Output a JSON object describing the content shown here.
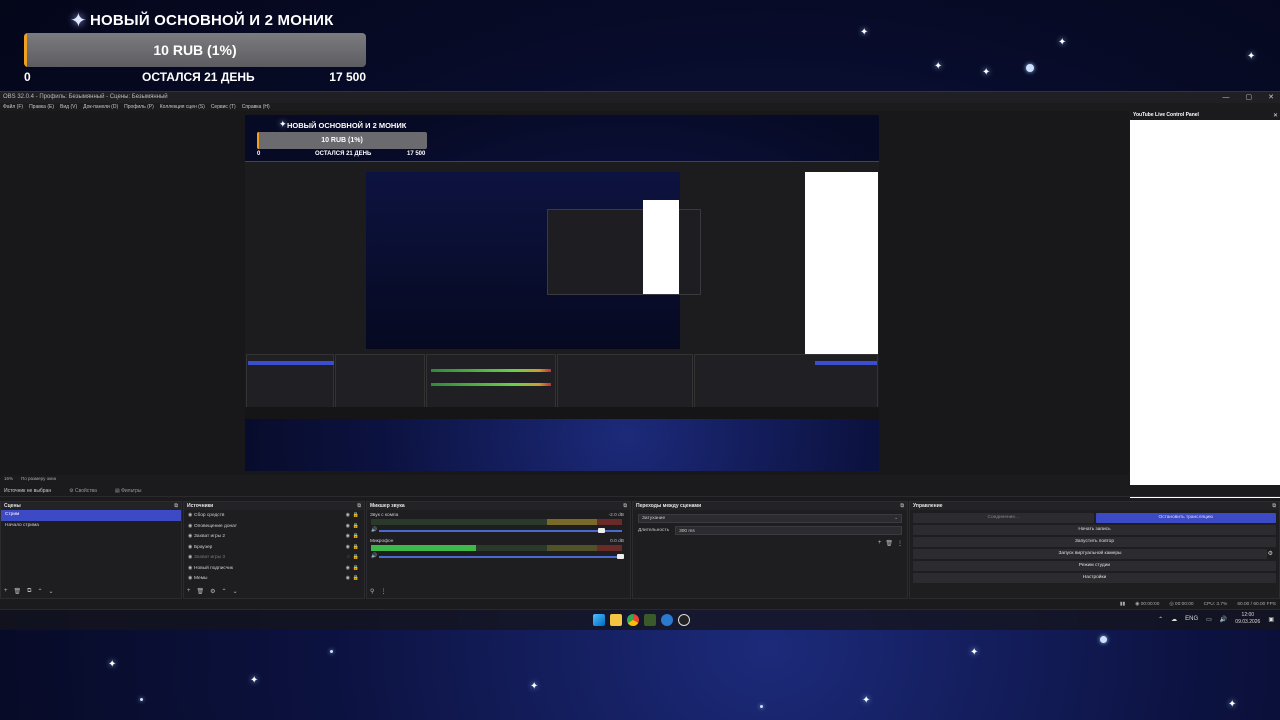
{
  "overlay": {
    "goal_title": "НОВЫЙ ОСНОВНОЙ И 2 МОНИК",
    "goal_value": "10 RUB (1%)",
    "goal_progress_percent": 1,
    "goal_min": "0",
    "goal_remaining": "ОСТАЛСЯ 21 ДЕНЬ",
    "goal_max": "17 500"
  },
  "window": {
    "title": "OBS 32.0.4 - Профиль: Безымянный - Сцены: Безымянный",
    "controls": [
      "—",
      "▢",
      "✕"
    ]
  },
  "menu": [
    "Файл (F)",
    "Правка (E)",
    "Вид (V)",
    "Док-панели (D)",
    "Профиль (P)",
    "Коллекция сцен (S)",
    "Сервис (T)",
    "Справка (H)"
  ],
  "side_dock": {
    "title": "YouTube Live Control Panel",
    "close": "✕"
  },
  "zoombar": {
    "zoom": "16%",
    "fit": "По размеру окна"
  },
  "source_bar": {
    "label": "Источник не выбран",
    "properties": "Свойства",
    "filters": "Фильтры"
  },
  "scenes": {
    "title": "Сцены",
    "items": [
      {
        "label": "Стрим",
        "selected": true
      },
      {
        "label": "Начало стрима",
        "selected": false
      }
    ],
    "footer": [
      "+",
      "🗑",
      "⧉",
      "⌃",
      "⌄"
    ]
  },
  "sources": {
    "title": "Источники",
    "items": [
      {
        "label": "Сбор средств",
        "hidden": false
      },
      {
        "label": "Оповещение донат",
        "hidden": false
      },
      {
        "label": "Захват игры 2",
        "hidden": false
      },
      {
        "label": "Браузер",
        "hidden": false
      },
      {
        "label": "Захват игры 3",
        "hidden": true
      },
      {
        "label": "Новый подписчик",
        "hidden": false
      },
      {
        "label": "Мемы",
        "hidden": false
      }
    ],
    "footer": [
      "+",
      "🗑",
      "⚙",
      "⌃",
      "⌄"
    ]
  },
  "mixer": {
    "title": "Микшер звука",
    "channels": [
      {
        "name": "Звук с компа",
        "db": "-2.0 dB",
        "level": 0.0,
        "fader": 0.92
      },
      {
        "name": "Микрофон",
        "db": "0.0 dB",
        "level": 0.42,
        "fader": 1.0
      }
    ],
    "scale": [
      "-60",
      "-55",
      "-50",
      "-45",
      "-40",
      "-35",
      "-30",
      "-25",
      "-20",
      "-15",
      "-10",
      "-5",
      "0"
    ]
  },
  "transitions": {
    "title": "Переходы между сценами",
    "selected": "Затухание",
    "duration_label": "Длительность",
    "duration_value": "300 ms"
  },
  "controls": {
    "title": "Управление",
    "connecting": "Соединение...",
    "stop_stream": "Остановить трансляцию",
    "buttons": [
      "Начать запись",
      "Запустить повтор",
      "Запуск виртуальной камеры",
      "Режим студии",
      "Настройки"
    ]
  },
  "status": {
    "rec": "00:00:00",
    "stream": "00:00:00",
    "cpu": "CPU: 3.7%",
    "fps": "60.00 / 60.00 FPS"
  },
  "taskbar": {
    "lang": "ENG",
    "time": "12:00",
    "date": "09.03.2026"
  },
  "colors": {
    "accent": "#3d4ac6",
    "goal_fill": "#f0a020",
    "meter_green": "#3fb84a"
  }
}
